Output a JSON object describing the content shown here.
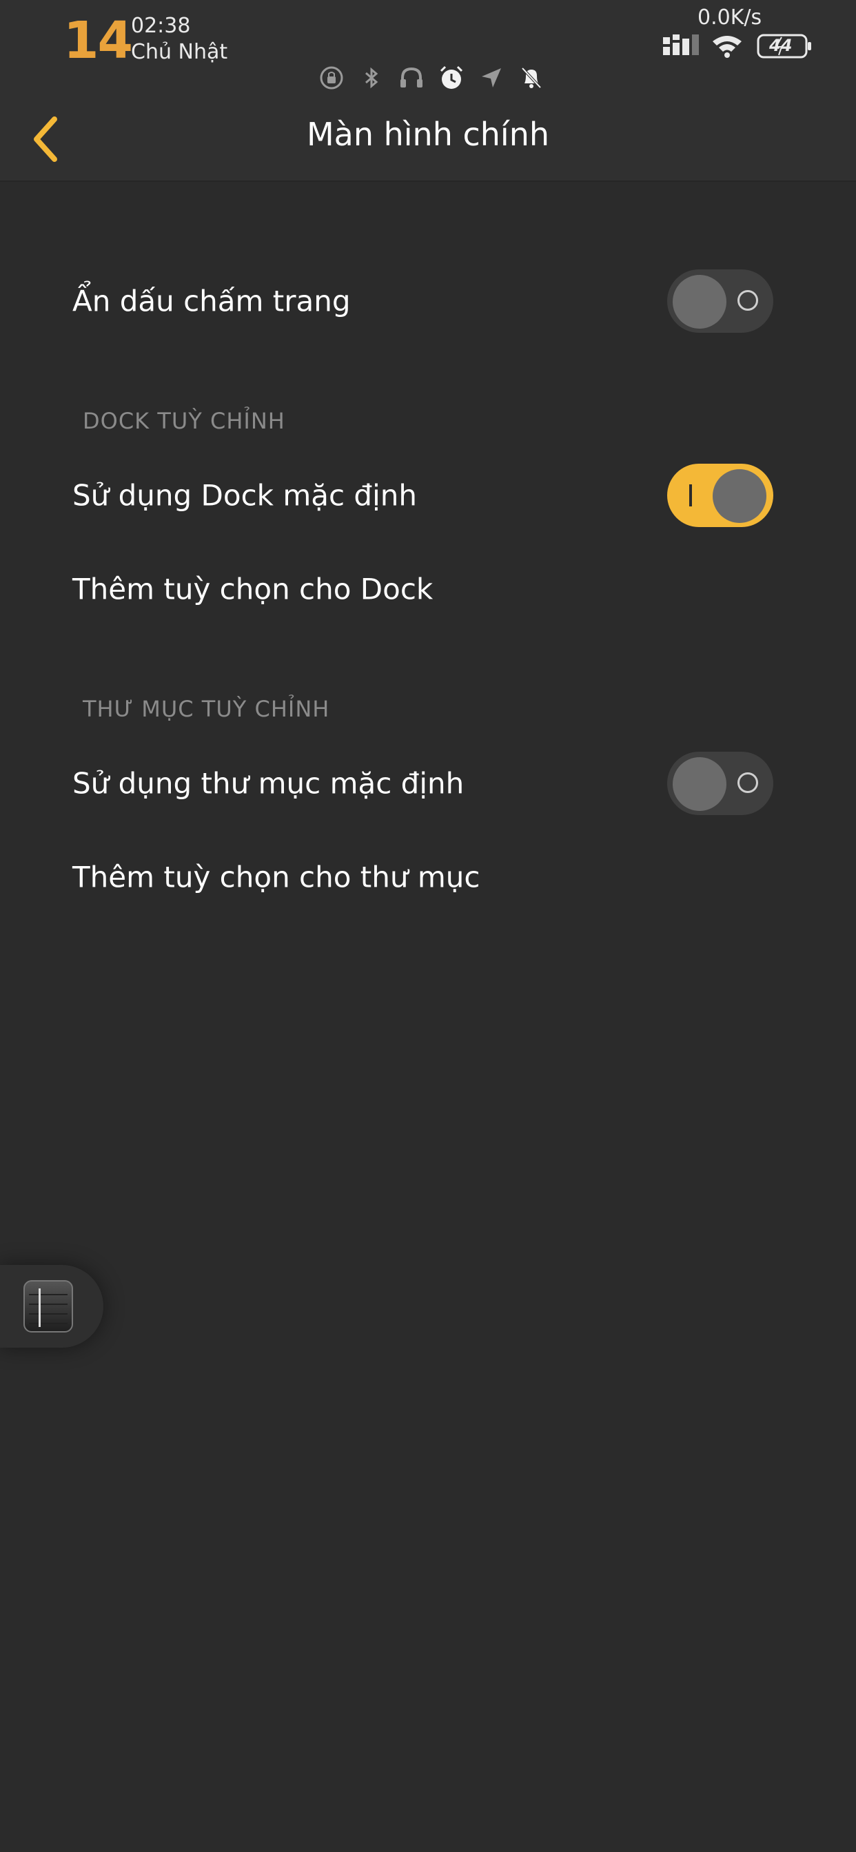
{
  "status_bar": {
    "day": "14",
    "time": "02:38",
    "weekday": "Chủ Nhật",
    "net_speed": "0.0K/s",
    "battery": "44",
    "icons": [
      "screen-rotation-lock-icon",
      "bluetooth-icon",
      "headphones-icon",
      "alarm-icon",
      "location-icon",
      "silent-mode-icon"
    ]
  },
  "header": {
    "title": "Màn hình chính",
    "back_icon": "chevron-left-icon"
  },
  "settings": {
    "hide_page_dots": {
      "label": "Ẩn dấu chấm trang",
      "enabled": false
    },
    "dock_section": {
      "header": "DOCK TUỲ CHỈNH",
      "use_default_dock": {
        "label": "Sử dụng Dock mặc định",
        "enabled": true
      },
      "dock_options": {
        "label": "Thêm tuỳ chọn cho Dock"
      }
    },
    "folder_section": {
      "header": "THƯ MỤC TUỲ CHỈNH",
      "use_default_folder": {
        "label": "Sử dụng thư mục mặc định",
        "enabled": false
      },
      "folder_options": {
        "label": "Thêm tuỳ chọn cho thư mục"
      }
    }
  },
  "colors": {
    "accent": "#f4b837",
    "background": "#2b2b2b",
    "day_number": "#e9a23b"
  }
}
